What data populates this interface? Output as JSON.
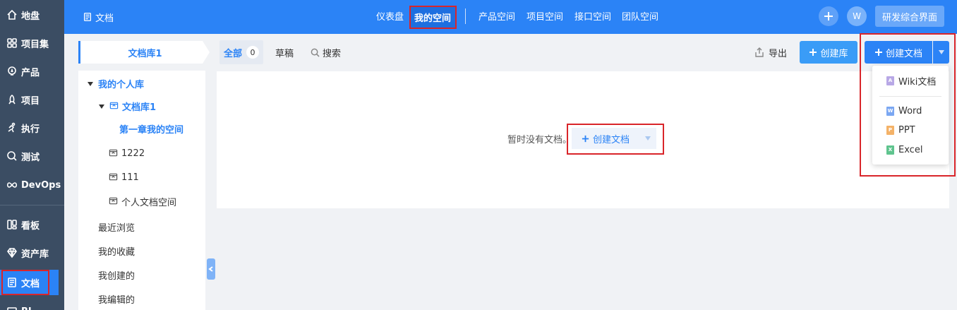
{
  "sidebar": {
    "items": [
      {
        "label": "地盘",
        "icon": "home-icon"
      },
      {
        "label": "项目集",
        "icon": "grid-icon"
      },
      {
        "label": "产品",
        "icon": "bulb-icon"
      },
      {
        "label": "项目",
        "icon": "rocket-icon"
      },
      {
        "label": "执行",
        "icon": "run-icon"
      },
      {
        "label": "测试",
        "icon": "search-icon"
      },
      {
        "label": "DevOps",
        "icon": "infinity-icon"
      },
      {
        "label": "看板",
        "icon": "kanban-icon"
      },
      {
        "label": "资产库",
        "icon": "diamond-icon"
      },
      {
        "label": "文档",
        "icon": "doc-icon"
      },
      {
        "label": "BI",
        "icon": "chart-icon"
      }
    ]
  },
  "header": {
    "title": "文档",
    "nav": [
      "仪表盘",
      "我的空间",
      "产品空间",
      "项目空间",
      "接口空间",
      "团队空间"
    ],
    "avatar": "W",
    "workspace": "研发综合界面"
  },
  "library": {
    "tab": "文档库1"
  },
  "tree": {
    "root": "我的个人库",
    "lib": "文档库1",
    "chapter": "第一章我的空间",
    "others": [
      "1222",
      "111",
      "个人文档空间"
    ],
    "links": [
      "最近浏览",
      "我的收藏",
      "我创建的",
      "我编辑的"
    ]
  },
  "filters": {
    "all": "全部",
    "all_count": "0",
    "draft": "草稿",
    "search": "搜索"
  },
  "toolbar": {
    "export": "导出",
    "create_lib": "创建库",
    "create_doc": "创建文档"
  },
  "empty": {
    "text": "暂时没有文档。",
    "create": "创建文档"
  },
  "dropdown": {
    "items": [
      "Wiki文档",
      "Word",
      "PPT",
      "Excel"
    ]
  },
  "colors": {
    "primary": "#2b83f6",
    "sidebar": "#3b4d63",
    "highlight": "#d9252a"
  }
}
